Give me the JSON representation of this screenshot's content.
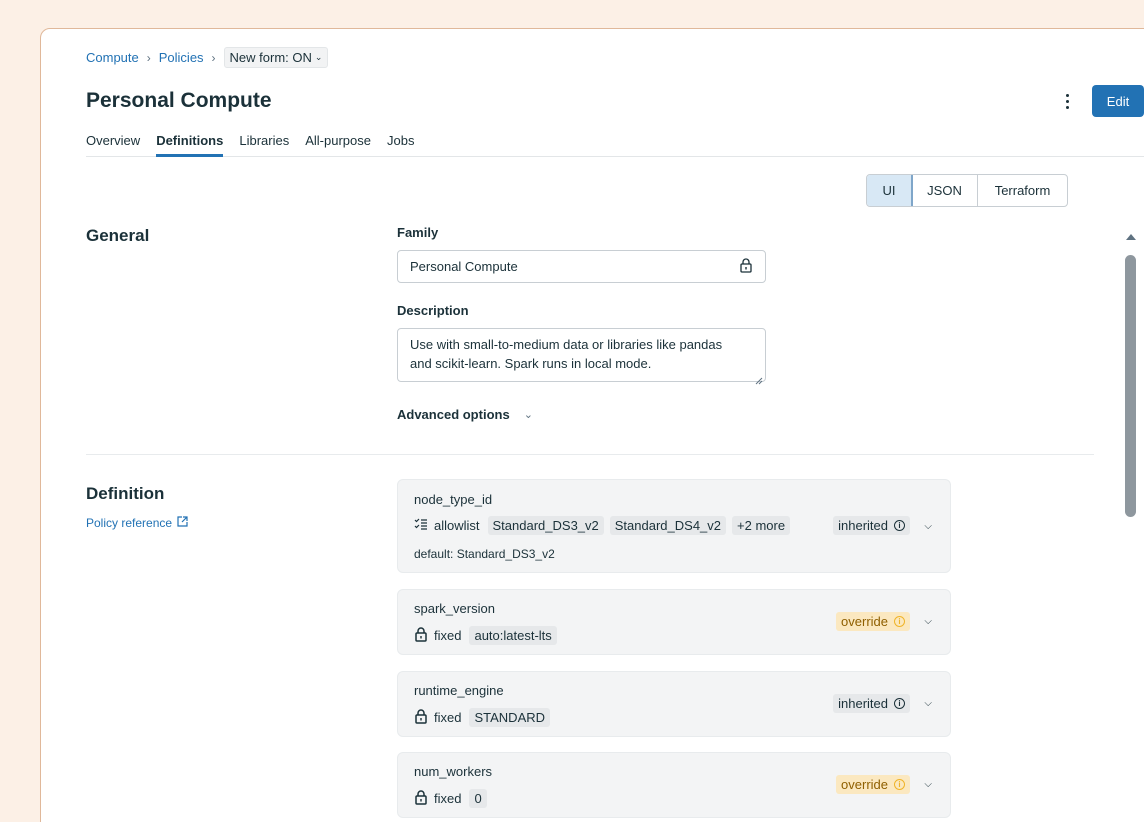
{
  "breadcrumb": {
    "items": [
      "Compute",
      "Policies"
    ],
    "separator": "›",
    "form_toggle": "New form: ON"
  },
  "header": {
    "title": "Personal Compute",
    "edit_label": "Edit"
  },
  "tabs": [
    {
      "label": "Overview",
      "active": false
    },
    {
      "label": "Definitions",
      "active": true
    },
    {
      "label": "Libraries",
      "active": false
    },
    {
      "label": "All-purpose",
      "active": false
    },
    {
      "label": "Jobs",
      "active": false
    }
  ],
  "view_toggle": {
    "options": [
      "UI",
      "JSON",
      "Terraform"
    ],
    "selected": "UI"
  },
  "general": {
    "title": "General",
    "family_label": "Family",
    "family_value": "Personal Compute",
    "description_label": "Description",
    "description_line1": "Use with small-to-medium data or libraries like pandas",
    "description_line2": "and scikit-learn. Spark runs in local mode.",
    "advanced_label": "Advanced options"
  },
  "definition": {
    "title": "Definition",
    "policy_reference": "Policy reference",
    "attributes": [
      {
        "name": "node_type_id",
        "kind": "allowlist",
        "values": [
          "Standard_DS3_v2",
          "Standard_DS4_v2",
          "+2 more"
        ],
        "status": "inherited",
        "default": "default: Standard_DS3_v2"
      },
      {
        "name": "spark_version",
        "kind": "fixed",
        "values": [
          "auto:latest-lts"
        ],
        "status": "override"
      },
      {
        "name": "runtime_engine",
        "kind": "fixed",
        "values": [
          "STANDARD"
        ],
        "status": "inherited"
      },
      {
        "name": "num_workers",
        "kind": "fixed",
        "values": [
          "0"
        ],
        "status": "override"
      }
    ]
  },
  "colors": {
    "accent": "#2272b4",
    "override_bg": "#fbe8c0",
    "page_bg": "#fcf0e6"
  }
}
